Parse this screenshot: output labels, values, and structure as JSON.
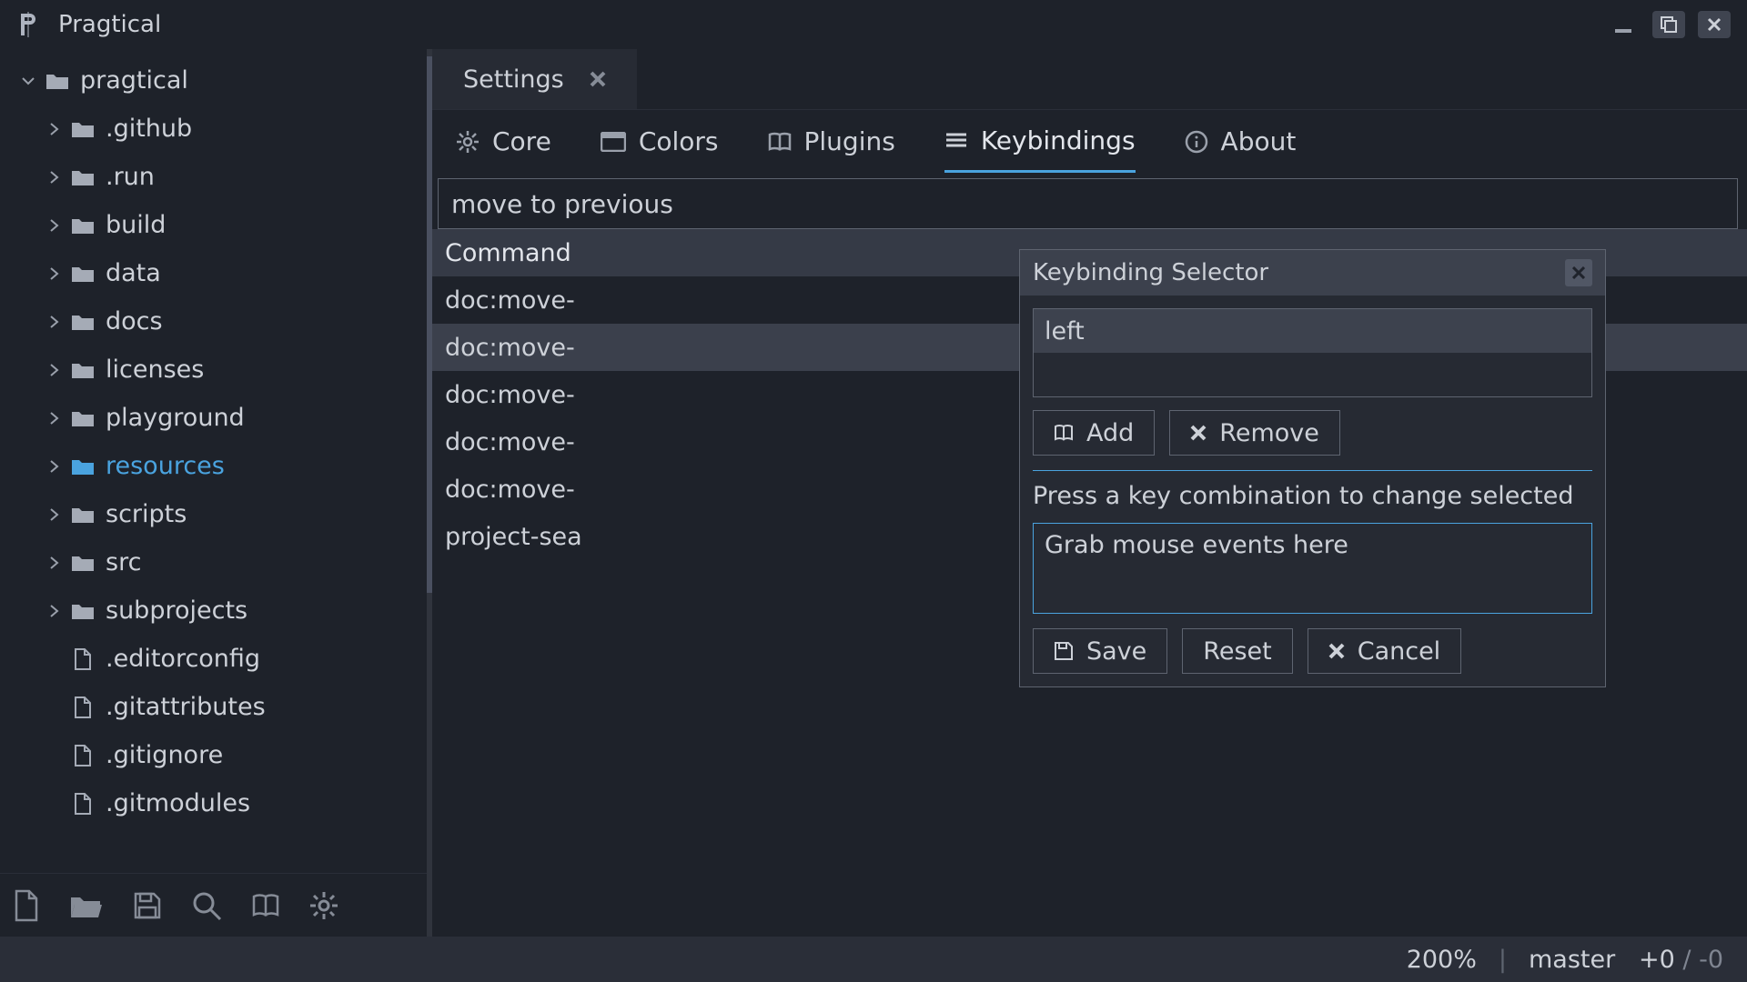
{
  "titlebar": {
    "title": "Pragtical"
  },
  "sidebar": {
    "root": "pragtical",
    "folders": [
      ".github",
      ".run",
      "build",
      "data",
      "docs",
      "licenses",
      "playground",
      "resources",
      "scripts",
      "src",
      "subprojects"
    ],
    "active_folder_index": 7,
    "files": [
      ".editorconfig",
      ".gitattributes",
      ".gitignore",
      ".gitmodules"
    ]
  },
  "tab": {
    "label": "Settings"
  },
  "subnav": {
    "items": [
      "Core",
      "Colors",
      "Plugins",
      "Keybindings",
      "About"
    ],
    "active_index": 3
  },
  "filter": {
    "value": "move to previous"
  },
  "kb_table": {
    "header": "Command",
    "rows": [
      "doc:move-",
      "doc:move-",
      "doc:move-",
      "doc:move-",
      "doc:move-",
      "project-sea"
    ],
    "selected_index": 1
  },
  "modal": {
    "title": "Keybinding Selector",
    "keys": [
      "left",
      ""
    ],
    "selected_key_index": 0,
    "add_label": "Add",
    "remove_label": "Remove",
    "hint": "Press a key combination to change selected",
    "grab_placeholder": "Grab mouse events here",
    "save_label": "Save",
    "reset_label": "Reset",
    "cancel_label": "Cancel"
  },
  "status": {
    "zoom": "200%",
    "branch": "master",
    "diff_add": "+0",
    "diff_sep": "/",
    "diff_del": "-0"
  }
}
